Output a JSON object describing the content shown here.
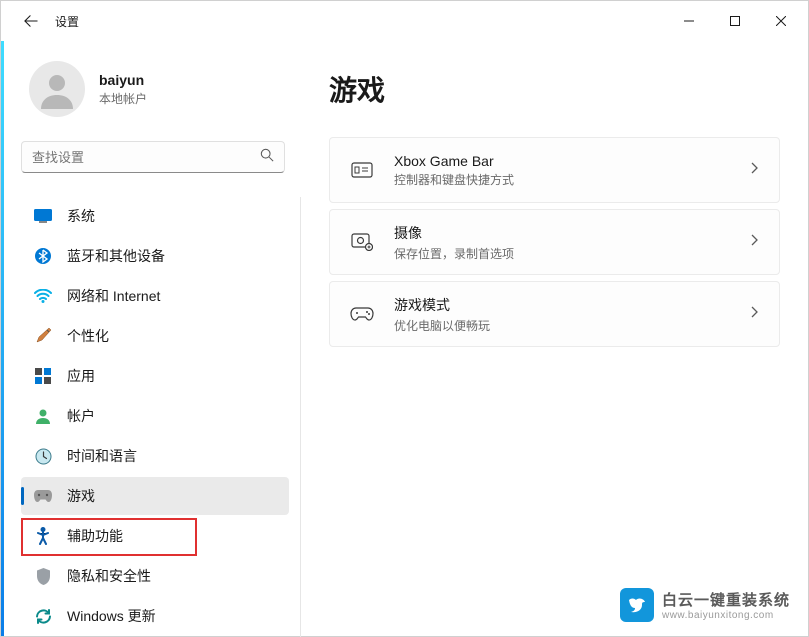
{
  "titlebar": {
    "app_name": "设置"
  },
  "user": {
    "name": "baiyun",
    "account_type": "本地帐户"
  },
  "search": {
    "placeholder": "查找设置"
  },
  "nav": {
    "items": [
      {
        "id": "system",
        "label": "系统"
      },
      {
        "id": "bluetooth",
        "label": "蓝牙和其他设备"
      },
      {
        "id": "network",
        "label": "网络和 Internet"
      },
      {
        "id": "personalization",
        "label": "个性化"
      },
      {
        "id": "apps",
        "label": "应用"
      },
      {
        "id": "accounts",
        "label": "帐户"
      },
      {
        "id": "time",
        "label": "时间和语言"
      },
      {
        "id": "gaming",
        "label": "游戏"
      },
      {
        "id": "accessibility",
        "label": "辅助功能"
      },
      {
        "id": "privacy",
        "label": "隐私和安全性"
      },
      {
        "id": "update",
        "label": "Windows 更新"
      }
    ],
    "active_index": 7
  },
  "page": {
    "title": "游戏"
  },
  "cards": [
    {
      "id": "xbox",
      "title": "Xbox Game Bar",
      "subtitle": "控制器和键盘快捷方式"
    },
    {
      "id": "captures",
      "title": "摄像",
      "subtitle": "保存位置，录制首选项"
    },
    {
      "id": "gamemode",
      "title": "游戏模式",
      "subtitle": "优化电脑以便畅玩"
    }
  ],
  "watermark": {
    "title": "白云一键重装系统",
    "url": "www.baiyunxitong.com"
  }
}
